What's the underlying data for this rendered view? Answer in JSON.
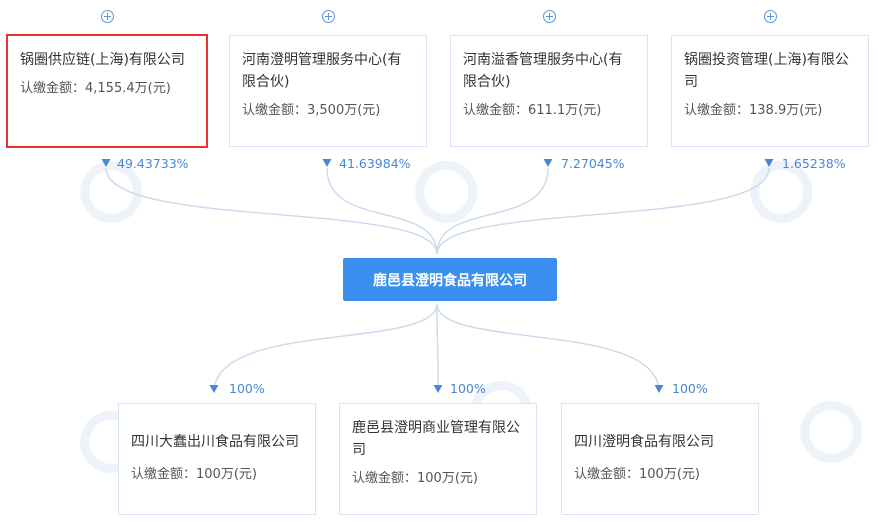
{
  "center": {
    "name": "鹿邑县澄明食品有限公司"
  },
  "shareholders": [
    {
      "name": "锅圈供应链(上海)有限公司",
      "amount": "认缴金额：4,155.4万(元)",
      "percent": "49.43733%",
      "highlighted": true
    },
    {
      "name": "河南澄明管理服务中心(有限合伙)",
      "amount": "认缴金额：3,500万(元)",
      "percent": "41.63984%",
      "highlighted": false
    },
    {
      "name": "河南溢香管理服务中心(有限合伙)",
      "amount": "认缴金额：611.1万(元)",
      "percent": "7.27045%",
      "highlighted": false
    },
    {
      "name": "锅圈投资管理(上海)有限公司",
      "amount": "认缴金额：138.9万(元)",
      "percent": "1.65238%",
      "highlighted": false
    }
  ],
  "subsidiaries": [
    {
      "name": "四川大蠢出川食品有限公司",
      "amount": "认缴金额：100万(元)",
      "percent": "100%"
    },
    {
      "name": "鹿邑县澄明商业管理有限公司",
      "amount": "认缴金额：100万(元)",
      "percent": "100%"
    },
    {
      "name": "四川澄明食品有限公司",
      "amount": "认缴金额：100万(元)",
      "percent": "100%"
    }
  ],
  "colors": {
    "accent": "#3b8fee",
    "line": "#c9d9ee",
    "arrow": "#4a86d4",
    "highlight_border": "#e8312f",
    "card_border": "#d6e4f5"
  },
  "icons": {
    "expand": "plus-circle-icon",
    "arrow": "arrow-down-icon"
  }
}
